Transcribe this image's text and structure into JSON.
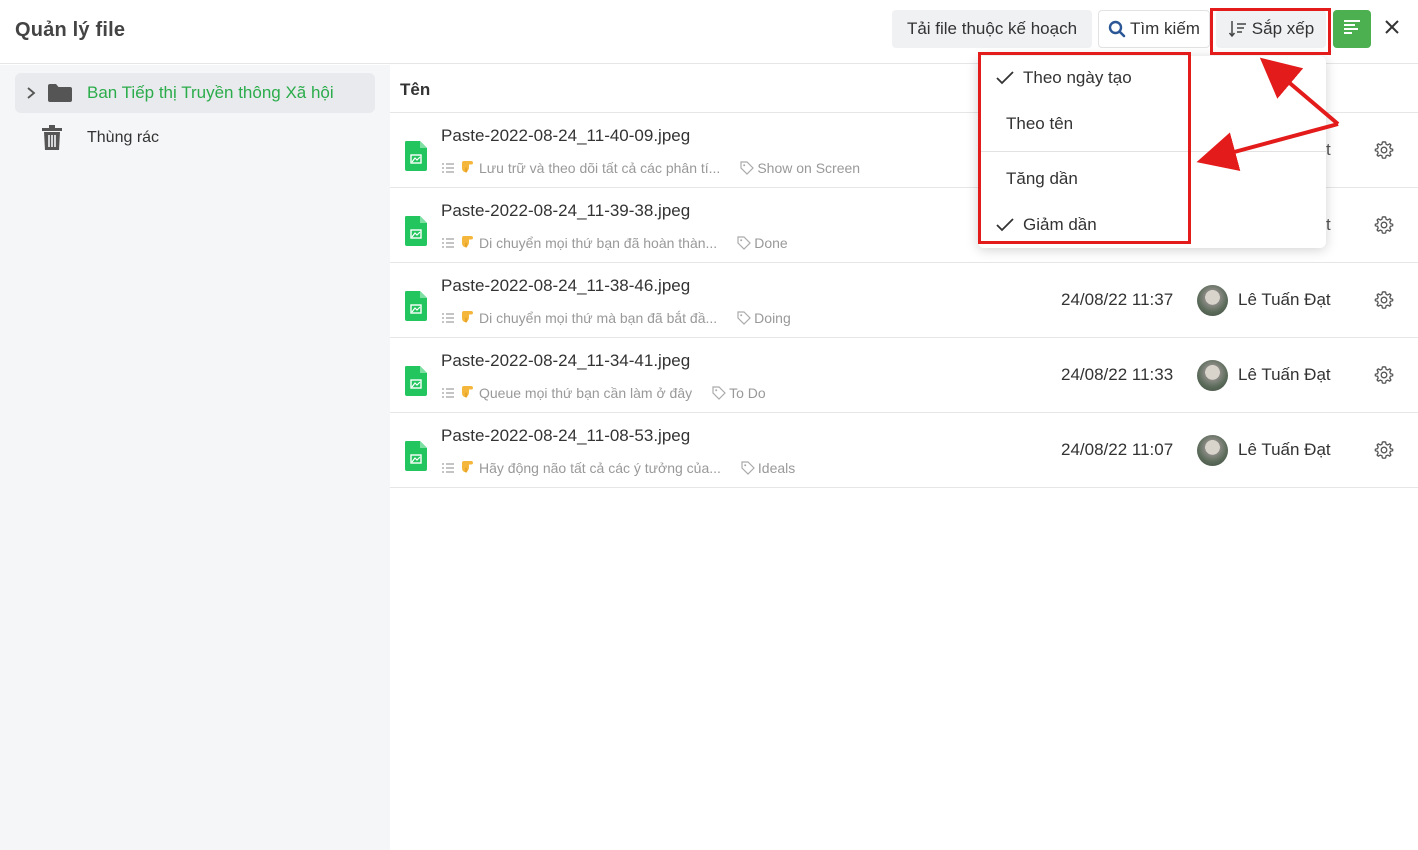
{
  "header": {
    "title": "Quản lý file",
    "plan_files_label": "Tải file thuộc kế hoạch",
    "search_label": "Tìm kiếm",
    "sort_label": "Sắp xếp",
    "menu_icon": "align-left-icon",
    "close_icon": "close-icon",
    "accent_color": "#4caf50"
  },
  "sidebar": {
    "items": [
      {
        "label": "Ban Tiếp thị Truyền thông Xã hội",
        "icon": "folder-icon",
        "expand_icon": "chevron-right-icon"
      },
      {
        "label": "Thùng rác",
        "icon": "trash-icon"
      }
    ]
  },
  "list": {
    "column_name": "Tên",
    "rows": [
      {
        "file": "Paste-2022-08-24_11-40-09.jpeg",
        "desc": "Lưu trữ và theo dõi tất cả các phân tí...",
        "tag": "Show on Screen",
        "date": "",
        "user": "",
        "partial": "t"
      },
      {
        "file": "Paste-2022-08-24_11-39-38.jpeg",
        "desc": "Di chuyển mọi thứ bạn đã hoàn thàn...",
        "tag": "Done",
        "date": "",
        "user": "",
        "partial": "t"
      },
      {
        "file": "Paste-2022-08-24_11-38-46.jpeg",
        "desc": "Di chuyển mọi thứ mà bạn đã bắt đầ...",
        "tag": "Doing",
        "date": "24/08/22 11:37",
        "user": "Lê Tuấn Đạt",
        "partial": ""
      },
      {
        "file": "Paste-2022-08-24_11-34-41.jpeg",
        "desc": "Queue mọi thứ bạn cần làm ở đây",
        "tag": "To Do",
        "date": "24/08/22 11:33",
        "user": "Lê Tuấn Đạt",
        "partial": ""
      },
      {
        "file": "Paste-2022-08-24_11-08-53.jpeg",
        "desc": "Hãy động não tất cả các ý tưởng của...",
        "tag": "Ideals",
        "date": "24/08/22 11:07",
        "user": "Lê Tuấn Đạt",
        "partial": ""
      }
    ]
  },
  "sort_menu": {
    "by_created": "Theo ngày tạo",
    "by_name": "Theo tên",
    "ascending": "Tăng dần",
    "descending": "Giảm dần"
  },
  "colors": {
    "file_green": "#22c55e",
    "sidebar_active_text": "#2bac4b",
    "annotation_red": "#e41b1b"
  }
}
